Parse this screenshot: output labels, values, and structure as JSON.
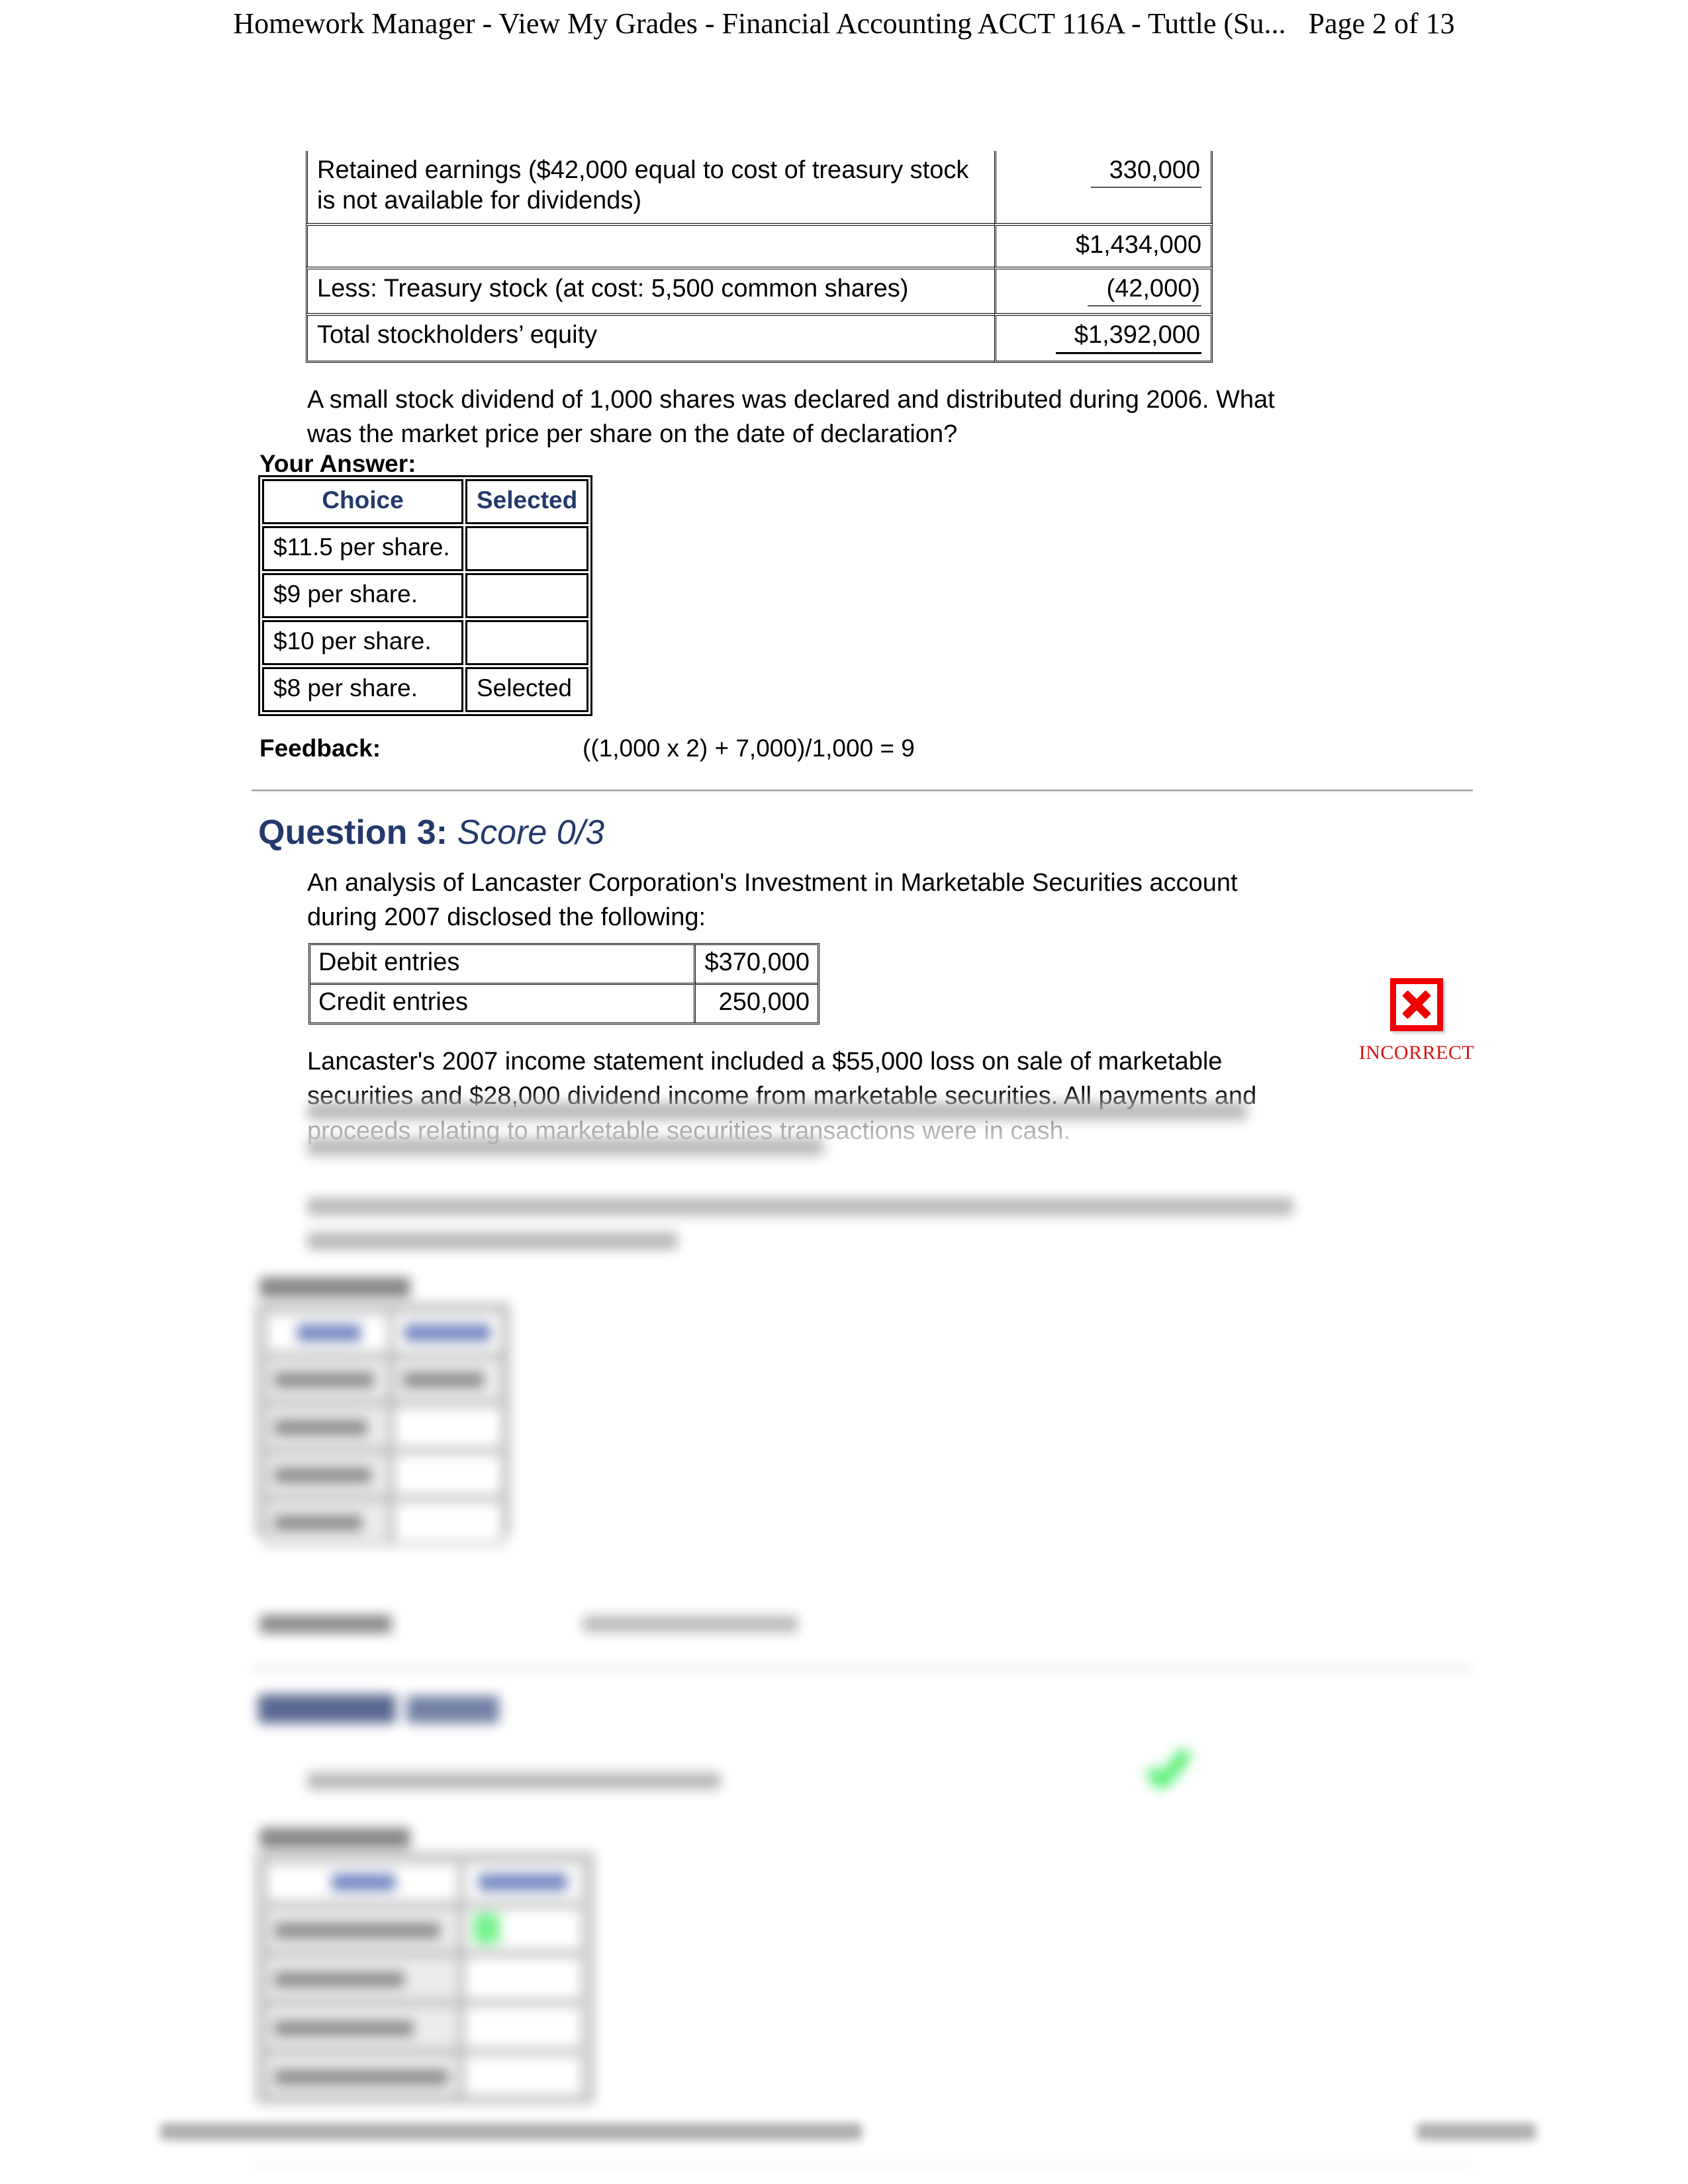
{
  "header": {
    "title": "Homework Manager - View My Grades - Financial Accounting ACCT 116A - Tuttle (Su...",
    "page_indicator": "Page 2 of 13"
  },
  "equity_table": {
    "rows": [
      {
        "label": "Retained earnings ($42,000 equal to cost of treasury stock is not available for dividends)",
        "value": "330,000"
      },
      {
        "label": "",
        "value": "$1,434,000"
      },
      {
        "label": "Less: Treasury stock (at cost: 5,500 common shares)",
        "value": "(42,000)"
      },
      {
        "label": "Total stockholders’ equity",
        "value": "$1,392,000"
      }
    ]
  },
  "question2": {
    "prompt": "A small stock dividend of 1,000 shares was declared and distributed during 2006. What was the market price per share on the date of declaration?",
    "your_answer_label": "Your Answer:",
    "columns": [
      "Choice",
      "Selected"
    ],
    "choices": [
      {
        "label": "$11.5 per share.",
        "selected": ""
      },
      {
        "label": "$9 per share.",
        "selected": ""
      },
      {
        "label": "$10 per share.",
        "selected": ""
      },
      {
        "label": "$8 per share.",
        "selected": "Selected"
      }
    ],
    "feedback_label": "Feedback:",
    "feedback_text": "((1,000 x 2) + 7,000)/1,000 = 9"
  },
  "question3": {
    "heading": "Question 3:",
    "score": "Score 0/3",
    "intro": "An analysis of Lancaster Corporation's Investment in Marketable Securities account during 2007 disclosed the following:",
    "entries": [
      {
        "label": "Debit entries",
        "value": "$370,000"
      },
      {
        "label": "Credit entries",
        "value": "250,000"
      }
    ],
    "body": "Lancaster's 2007 income statement included a $55,000 loss on sale of marketable securities and $28,000 dividend income from marketable securities. All payments and proceeds relating to marketable securities transactions were in cash.",
    "body2": "How much cash was used by Lancaster Corporation in 2007 for the purchase of marketable securities?",
    "your_answer_label": "Your Answer:",
    "columns": [
      "Choice",
      "Selected"
    ],
    "status": {
      "icon": "red-x-icon",
      "label": "INCORRECT",
      "color": "#dd1111"
    },
    "feedback_label": "Feedback:"
  },
  "question4": {
    "heading": "Question 4:",
    "score": "Score 3/3",
    "prompt": "Dividends are first recorded and retained earnings are reduced on:",
    "your_answer_label": "Your Answer:",
    "columns": [
      "Choice",
      "Selected"
    ],
    "choices": [
      {
        "label": "The date of declaration.",
        "selected": "checked"
      },
      {
        "label": "The date of record.",
        "selected": ""
      },
      {
        "label": "The date of payment.",
        "selected": ""
      },
      {
        "label": "The last day of the fiscal year.",
        "selected": ""
      }
    ],
    "status": {
      "icon": "green-check-icon",
      "color": "#5ef07a"
    }
  },
  "colors": {
    "heading_blue": "#24396B",
    "incorrect_red": "#dd1111",
    "correct_green": "#5ef07a"
  }
}
